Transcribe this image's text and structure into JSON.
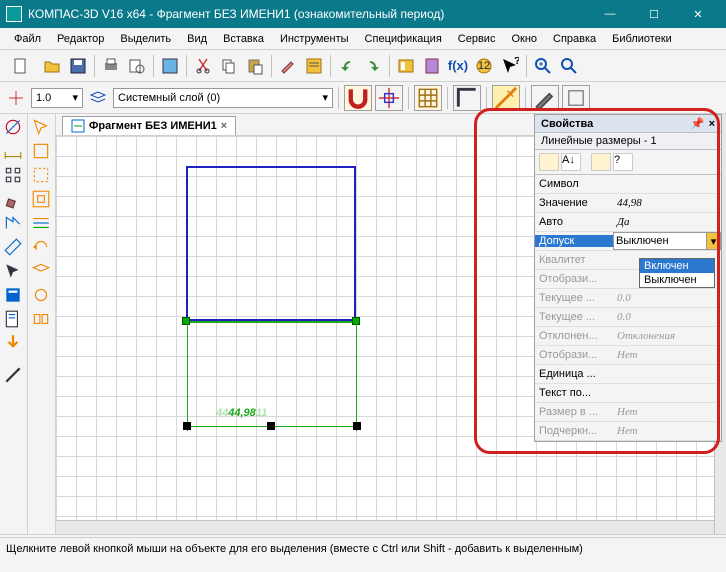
{
  "title": "КОМПАС-3D V16  x64 - Фрагмент БЕЗ ИМЕНИ1 (ознакомительный период)",
  "menu": [
    "Файл",
    "Редактор",
    "Выделить",
    "Вид",
    "Вставка",
    "Инструменты",
    "Спецификация",
    "Сервис",
    "Окно",
    "Справка",
    "Библиотеки"
  ],
  "toolbar2": {
    "scale": "1.0",
    "layer": "Системный слой (0)"
  },
  "tab": {
    "label": "Фрагмент БЕЗ ИМЕНИ1"
  },
  "dimension": {
    "value": "44,98"
  },
  "props": {
    "title": "Свойства",
    "subtitle": "Линейные размеры - 1",
    "rows": {
      "symbol": {
        "label": "Символ",
        "value": ""
      },
      "value": {
        "label": "Значение",
        "value": "44,98"
      },
      "auto": {
        "label": "Авто",
        "value": "Да"
      },
      "tol": {
        "label": "Допуск",
        "value": "Выключен"
      },
      "qual": {
        "label": "Квалитет",
        "value": ""
      },
      "disp1": {
        "label": "Отобрази...",
        "value": ""
      },
      "cur1": {
        "label": "Текущее ...",
        "value": "0.0"
      },
      "cur2": {
        "label": "Текущее ...",
        "value": "0.0"
      },
      "dev": {
        "label": "Отклонен...",
        "value": "Отклонения"
      },
      "disp2": {
        "label": "Отобрази...",
        "value": "Нет"
      },
      "unit": {
        "label": "Единица ...",
        "value": ""
      },
      "textp": {
        "label": "Текст по...",
        "value": ""
      },
      "dimin": {
        "label": "Размер в ...",
        "value": "Нет"
      },
      "under": {
        "label": "Подчеркн...",
        "value": "Нет"
      }
    },
    "dropdown": {
      "opt1": "Включен",
      "opt2": "Выключен"
    }
  },
  "status": "Щелкните левой кнопкой мыши на объекте для его выделения (вместе с Ctrl или Shift - добавить к выделенным)"
}
